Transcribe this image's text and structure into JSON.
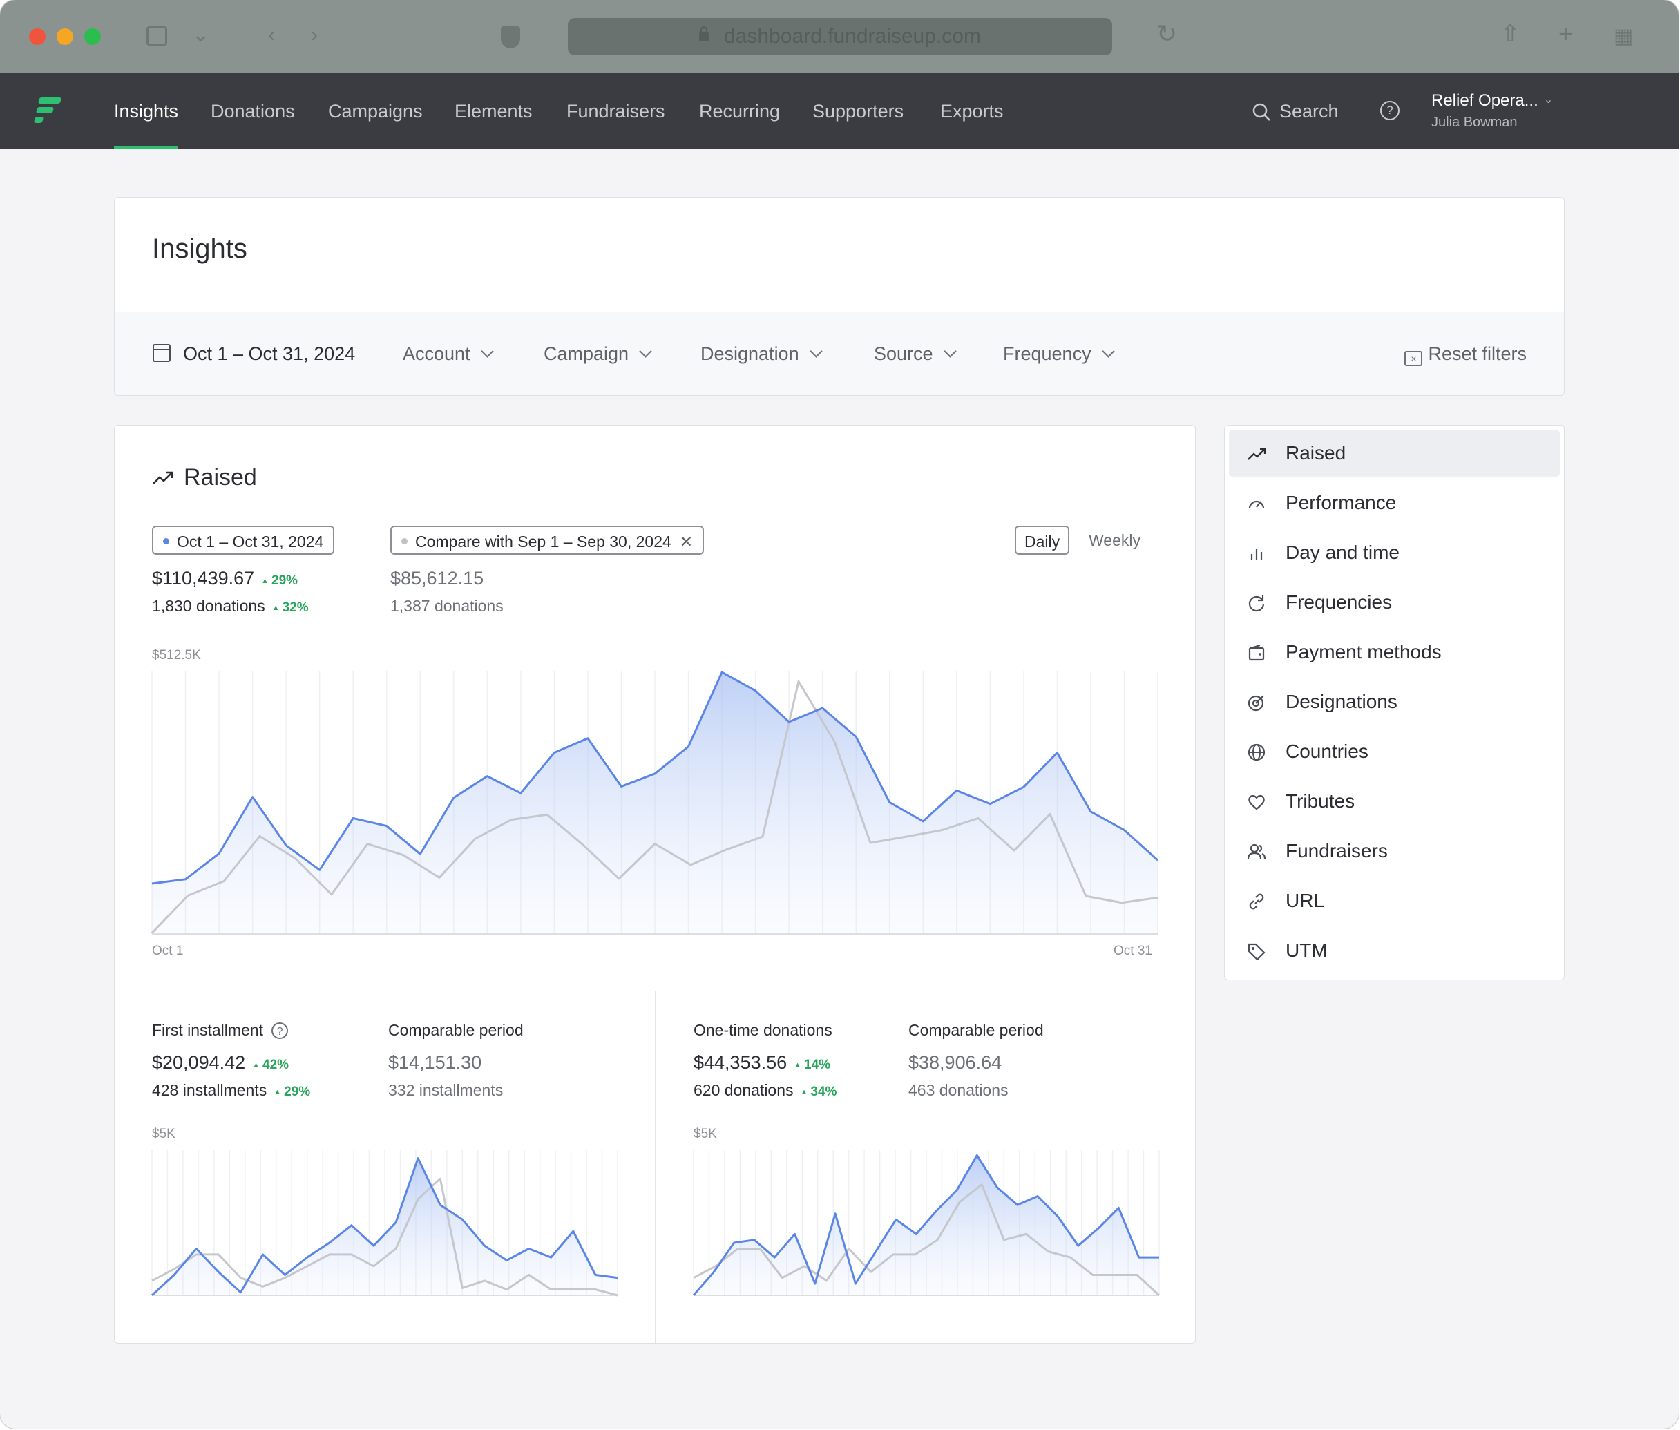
{
  "browser": {
    "url": "dashboard.fundraiseup.com",
    "traffic_lights": {
      "close": "#f0543e",
      "minimize": "#f5a623",
      "maximize": "#2bbd4e"
    }
  },
  "nav": {
    "items": [
      "Insights",
      "Donations",
      "Campaigns",
      "Elements",
      "Fundraisers",
      "Recurring",
      "Supporters",
      "Exports"
    ],
    "active_index": 0,
    "search_label": "Search",
    "account_name": "Relief Opera...",
    "user_name": "Julia Bowman",
    "accent": "#2fbf71"
  },
  "page": {
    "title": "Insights",
    "filters": {
      "date_range": "Oct 1 – Oct 31, 2024",
      "account": "Account",
      "campaign": "Campaign",
      "designation": "Designation",
      "source": "Source",
      "frequency": "Frequency",
      "reset": "Reset filters"
    }
  },
  "raised": {
    "title": "Raised",
    "current_period": "Oct 1 – Oct 31, 2024",
    "compare_period": "Compare with Sep 1 – Sep 30, 2024",
    "toggle_daily": "Daily",
    "toggle_weekly": "Weekly",
    "current_amount": "$110,439.67",
    "current_amount_delta": "29%",
    "current_donations": "1,830 donations",
    "current_donations_delta": "32%",
    "compare_amount": "$85,612.15",
    "compare_donations": "1,387 donations"
  },
  "first_installment": {
    "title": "First installment",
    "amount": "$20,094.42",
    "amount_delta": "42%",
    "count": "428 installments",
    "count_delta": "29%",
    "comparable_title": "Comparable period",
    "comparable_amount": "$14,151.30",
    "comparable_count": "332 installments"
  },
  "one_time": {
    "title": "One-time donations",
    "amount": "$44,353.56",
    "amount_delta": "14%",
    "count": "620 donations",
    "count_delta": "34%",
    "comparable_title": "Comparable period",
    "comparable_amount": "$38,906.64",
    "comparable_count": "463 donations"
  },
  "sidebar": {
    "items": [
      {
        "label": "Raised",
        "icon": "trend-up-icon"
      },
      {
        "label": "Performance",
        "icon": "gauge-icon"
      },
      {
        "label": "Day and time",
        "icon": "bar-chart-icon"
      },
      {
        "label": "Frequencies",
        "icon": "refresh-icon"
      },
      {
        "label": "Payment methods",
        "icon": "wallet-icon"
      },
      {
        "label": "Designations",
        "icon": "target-icon"
      },
      {
        "label": "Countries",
        "icon": "globe-icon"
      },
      {
        "label": "Tributes",
        "icon": "heart-icon"
      },
      {
        "label": "Fundraisers",
        "icon": "users-icon"
      },
      {
        "label": "URL",
        "icon": "link-icon"
      },
      {
        "label": "UTM",
        "icon": "tag-icon"
      }
    ],
    "active_index": 0
  },
  "chart_data": [
    {
      "type": "area",
      "title": "Raised",
      "y_max_label": "$512.5K",
      "ylim": [
        0,
        512500
      ],
      "x_labels": [
        "Oct 1",
        "Oct 31"
      ],
      "x": [
        1,
        2,
        3,
        4,
        5,
        6,
        7,
        8,
        9,
        10,
        11,
        12,
        13,
        14,
        15,
        16,
        17,
        18,
        19,
        20,
        21,
        22,
        23,
        24,
        25,
        26,
        27,
        28,
        29,
        30,
        31
      ],
      "series": [
        {
          "role": "current",
          "color": "#5b86e5",
          "values": [
            98500,
            106800,
            157000,
            267500,
            173000,
            125000,
            226000,
            211000,
            156000,
            266000,
            308000,
            275000,
            354000,
            382000,
            288000,
            313000,
            366000,
            511000,
            475000,
            414000,
            441000,
            385000,
            257000,
            220000,
            280000,
            254000,
            287000,
            354000,
            239000,
            203000,
            144000
          ]
        },
        {
          "role": "compare",
          "color": "#c5c7cc",
          "values": [
            2000,
            75000,
            103000,
            191000,
            147000,
            77000,
            176000,
            154000,
            110000,
            186000,
            223000,
            233000,
            174000,
            108000,
            176000,
            135000,
            165000,
            190000,
            493000,
            376000,
            178000,
            190000,
            203000,
            226000,
            163000,
            234000,
            74000,
            61000,
            71000
          ]
        }
      ]
    },
    {
      "type": "area",
      "title": "First installment",
      "y_max_label": "$5K",
      "ylim": [
        0,
        5000
      ],
      "series": [
        {
          "role": "current",
          "color": "#5b86e5",
          "values": [
            0,
            700,
            1600,
            800,
            100,
            1400,
            700,
            1300,
            1800,
            2400,
            1700,
            2500,
            4700,
            3100,
            2600,
            1700,
            1200,
            1600,
            1300,
            2200,
            700,
            600
          ]
        },
        {
          "role": "compare",
          "color": "#c5c7cc",
          "values": [
            500,
            900,
            1400,
            1400,
            600,
            300,
            600,
            1000,
            1400,
            1400,
            1000,
            1600,
            3300,
            4000,
            250,
            500,
            200,
            700,
            200,
            200,
            200,
            0
          ]
        }
      ]
    },
    {
      "type": "area",
      "title": "One-time donations",
      "y_max_label": "$5K",
      "ylim": [
        0,
        5000
      ],
      "series": [
        {
          "role": "current",
          "color": "#5b86e5",
          "values": [
            0,
            800,
            1800,
            1900,
            1300,
            2100,
            400,
            2800,
            400,
            1500,
            2600,
            2100,
            2900,
            3600,
            4800,
            3700,
            3100,
            3400,
            2700,
            1700,
            2300,
            3000,
            1300,
            1300
          ]
        },
        {
          "role": "compare",
          "color": "#c5c7cc",
          "values": [
            600,
            1000,
            1600,
            1600,
            600,
            1000,
            500,
            1600,
            800,
            1400,
            1400,
            1900,
            3200,
            3800,
            1900,
            2100,
            1500,
            1300,
            700,
            700,
            700,
            0
          ]
        }
      ]
    }
  ]
}
